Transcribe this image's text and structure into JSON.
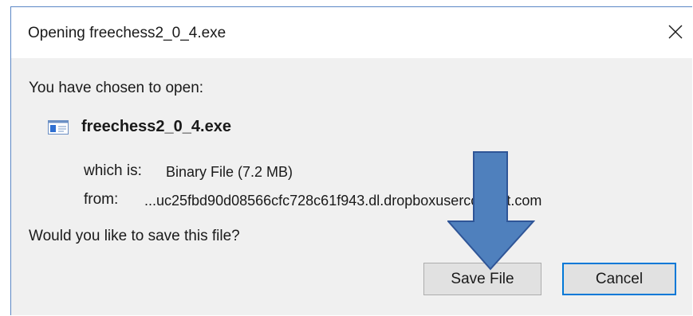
{
  "window": {
    "title": "Opening freechess2_0_4.exe"
  },
  "dialog": {
    "heading": "You have chosen to open:",
    "file_name": "freechess2_0_4.exe",
    "which_label": "which is:",
    "which_value": "Binary File (7.2 MB)",
    "from_label": "from:",
    "from_value": "...uc25fbd90d08566cfc728c61f943.dl.dropboxusercontent.com",
    "question": "Would you like to save this file?"
  },
  "buttons": {
    "save_label": "Save File",
    "cancel_label": "Cancel"
  },
  "icons": {
    "close": "close-icon",
    "file": "executable-file-icon",
    "arrow": "arrow-down-annotation"
  },
  "colors": {
    "accent": "#0078d7",
    "arrow_fill": "#4f80bd",
    "arrow_stroke": "#2f5597"
  }
}
